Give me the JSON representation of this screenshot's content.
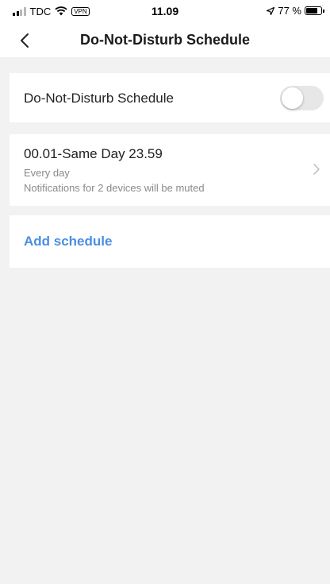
{
  "status_bar": {
    "carrier": "TDC",
    "vpn_label": "VPN",
    "time": "11.09",
    "battery_text": "77 %",
    "battery_level": 0.77,
    "signal_icon": "signal-bars-icon",
    "wifi_icon": "wifi-icon",
    "location_icon": "location-arrow-icon",
    "battery_icon": "battery-icon"
  },
  "nav": {
    "back_icon": "chevron-left-icon",
    "title": "Do-Not-Disturb Schedule"
  },
  "settings": {
    "toggle_label": "Do-Not-Disturb Schedule",
    "toggle_on": false
  },
  "schedule": {
    "title": "00.01-Same Day 23.59",
    "repeat": "Every day",
    "description": "Notifications for 2 devices will be muted",
    "chevron_icon": "chevron-right-icon"
  },
  "actions": {
    "add_schedule_label": "Add schedule"
  },
  "colors": {
    "accent": "#4a8ee3",
    "background": "#f2f2f2",
    "toggle_off": "#e7e7e7"
  }
}
